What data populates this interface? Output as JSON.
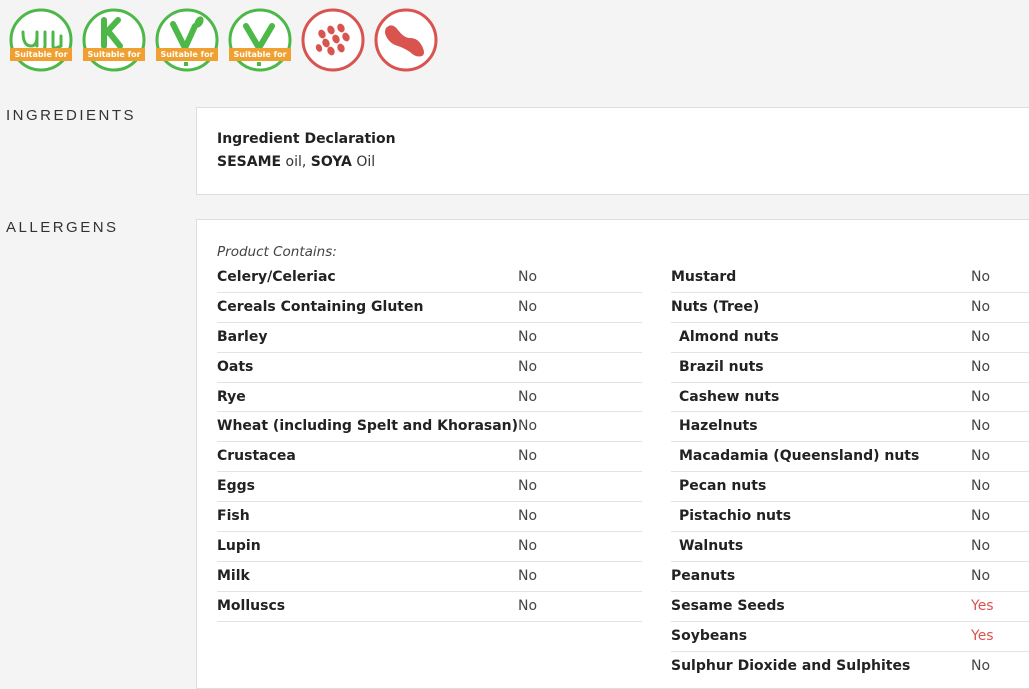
{
  "badges": [
    {
      "icon": "halal-icon",
      "band": "Suitable for",
      "color": "#4db848"
    },
    {
      "icon": "kosher-icon",
      "band": "Suitable for",
      "color": "#4db848"
    },
    {
      "icon": "vegetarian-icon",
      "band": "Suitable for",
      "color": "#4db848"
    },
    {
      "icon": "vegan-icon",
      "band": "Suitable for",
      "color": "#4db848"
    },
    {
      "icon": "sesame-seeds-icon",
      "color": "#d9534f"
    },
    {
      "icon": "soybean-icon",
      "color": "#d9534f"
    }
  ],
  "ingredients": {
    "label": "INGREDIENTS",
    "declaration_title": "Ingredient Declaration",
    "parts": [
      {
        "text": "SESAME",
        "bold": true
      },
      {
        "text": " oil, ",
        "bold": false
      },
      {
        "text": "SOYA",
        "bold": true
      },
      {
        "text": " Oil",
        "bold": false
      }
    ]
  },
  "allergens": {
    "label": "ALLERGENS",
    "contains_label": "Product Contains:",
    "left": [
      {
        "name": "Celery/Celeriac",
        "value": "No"
      },
      {
        "name": "Cereals Containing Gluten",
        "value": "No"
      },
      {
        "name": "Barley",
        "value": "No"
      },
      {
        "name": "Oats",
        "value": "No"
      },
      {
        "name": "Rye",
        "value": "No"
      },
      {
        "name": "Wheat (including Spelt and Khorasan)",
        "value": "No"
      },
      {
        "name": "Crustacea",
        "value": "No"
      },
      {
        "name": "Eggs",
        "value": "No"
      },
      {
        "name": "Fish",
        "value": "No"
      },
      {
        "name": "Lupin",
        "value": "No"
      },
      {
        "name": "Milk",
        "value": "No"
      },
      {
        "name": "Molluscs",
        "value": "No"
      }
    ],
    "right": [
      {
        "name": "Mustard",
        "value": "No",
        "sub": false
      },
      {
        "name": "Nuts (Tree)",
        "value": "No",
        "sub": false
      },
      {
        "name": "Almond nuts",
        "value": "No",
        "sub": true
      },
      {
        "name": "Brazil nuts",
        "value": "No",
        "sub": true
      },
      {
        "name": "Cashew nuts",
        "value": "No",
        "sub": true
      },
      {
        "name": "Hazelnuts",
        "value": "No",
        "sub": true
      },
      {
        "name": "Macadamia (Queensland) nuts",
        "value": "No",
        "sub": true
      },
      {
        "name": "Pecan nuts",
        "value": "No",
        "sub": true
      },
      {
        "name": "Pistachio nuts",
        "value": "No",
        "sub": true
      },
      {
        "name": "Walnuts",
        "value": "No",
        "sub": true
      },
      {
        "name": "Peanuts",
        "value": "No",
        "sub": false
      },
      {
        "name": "Sesame Seeds",
        "value": "Yes",
        "sub": false
      },
      {
        "name": "Soybeans",
        "value": "Yes",
        "sub": false
      },
      {
        "name": "Sulphur Dioxide and Sulphites",
        "value": "No",
        "sub": false
      }
    ],
    "yes_color": "#d9534f"
  }
}
